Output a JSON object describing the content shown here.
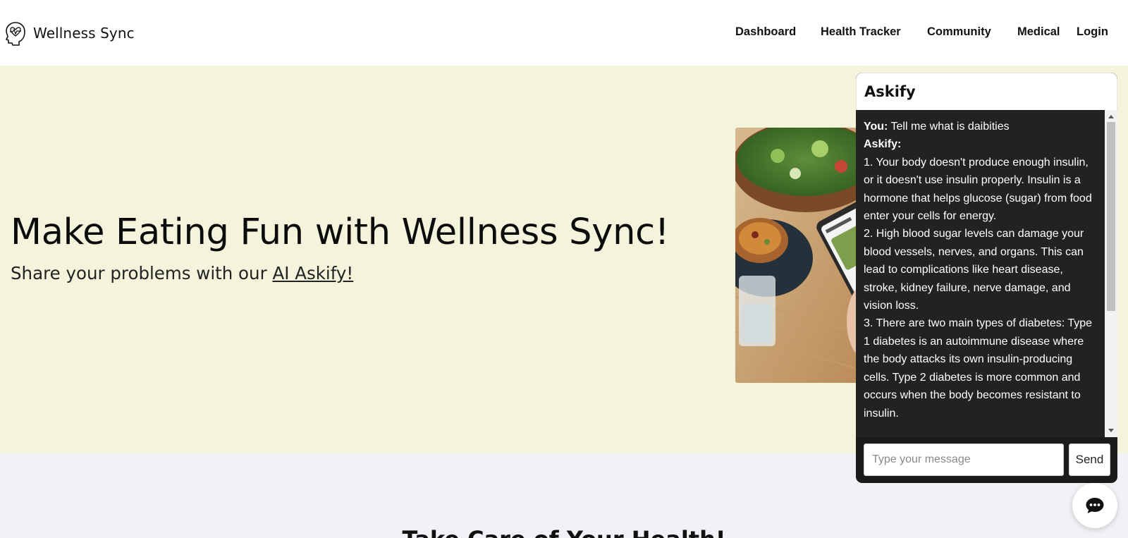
{
  "header": {
    "brand_name": "Wellness Sync",
    "logo_icon": "head-heartbeat-icon",
    "nav": [
      "Dashboard",
      "Health Tracker",
      "Community",
      "Medical",
      "Login"
    ]
  },
  "hero": {
    "title": "Make Eating Fun with Wellness Sync!",
    "subtitle_prefix": "Share your problems with our ",
    "subtitle_link": "AI Askify!",
    "background_color": "#f4f4dc"
  },
  "chat": {
    "title": "Askify",
    "user_label": "You:",
    "user_message": "Tell me what is daibities",
    "bot_label": "Askify:",
    "bot_lines": [
      "1. Your body doesn't produce enough insulin, or it doesn't use insulin properly. Insulin is a hormone that helps glucose (sugar) from food enter your cells for energy.",
      "2. High blood sugar levels can damage your blood vessels, nerves, and organs. This can lead to complications like heart disease, stroke, kidney failure, nerve damage, and vision loss.",
      "3. There are two main types of diabetes: Type 1 diabetes is an autoimmune disease where the body attacks its own insulin-producing cells. Type 2 diabetes is more common and occurs when the body becomes resistant to insulin."
    ],
    "input_placeholder": "Type your message",
    "send_label": "Send",
    "fab_icon": "chat-bubble-icon",
    "background_color": "#222222"
  },
  "section": {
    "title": "Take Care of Your Health!"
  }
}
